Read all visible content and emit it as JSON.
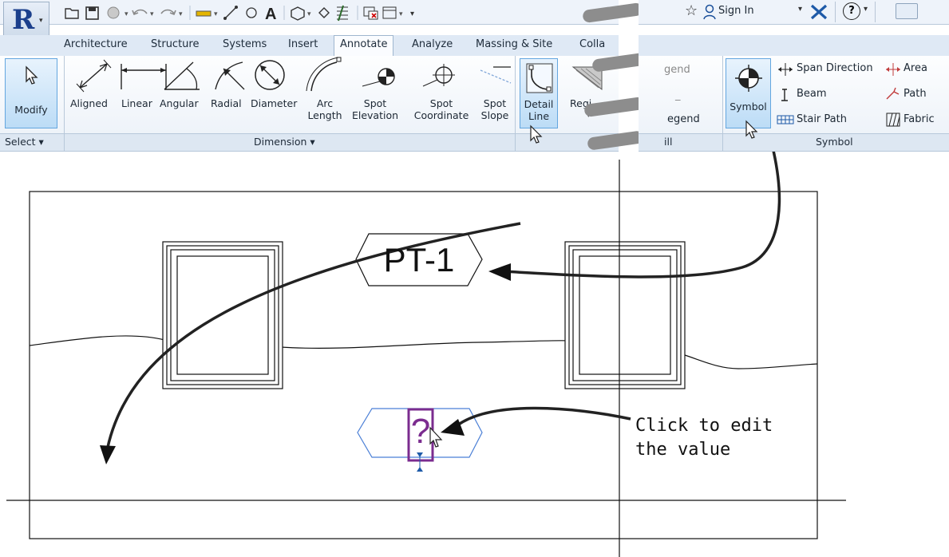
{
  "app": {
    "logo_letter": "R"
  },
  "tabs": [
    {
      "label": "Architecture"
    },
    {
      "label": "Structure"
    },
    {
      "label": "Systems"
    },
    {
      "label": "Insert"
    },
    {
      "label": "Annotate",
      "active": true
    },
    {
      "label": "Analyze"
    },
    {
      "label": "Massing & Site"
    },
    {
      "label": "Colla"
    }
  ],
  "qat_right": {
    "sign_in_label": "Sign In",
    "help_label": "?"
  },
  "select_panel": {
    "modify_label": "Modify",
    "title": "Select ▾"
  },
  "dimension_panel": {
    "title": "Dimension ▾",
    "tools": [
      {
        "line1": "Aligned",
        "line2": ""
      },
      {
        "line1": "Linear",
        "line2": ""
      },
      {
        "line1": "Angular",
        "line2": ""
      },
      {
        "line1": "Radial",
        "line2": ""
      },
      {
        "line1": "Diameter",
        "line2": ""
      },
      {
        "line1": "Arc",
        "line2": "Length"
      },
      {
        "line1": "Spot",
        "line2": "Elevation"
      },
      {
        "line1": "Spot",
        "line2": "Coordinate"
      },
      {
        "line1": "Spot",
        "line2": "Slope"
      }
    ]
  },
  "detail_panel": {
    "detail_line_1": "Detail",
    "detail_line_2": "Line",
    "region_label": "Regi"
  },
  "partial_panel": {
    "legend_label": "gend",
    "legend2_label": "egend",
    "title": "ill"
  },
  "symbol_panel": {
    "title": "Symbol",
    "symbol_label": "Symbol",
    "items": [
      {
        "label": "Span Direction"
      },
      {
        "label": "Beam"
      },
      {
        "label": "Stair Path"
      },
      {
        "label": "Area"
      },
      {
        "label": "Path"
      },
      {
        "label": "Fabric"
      }
    ]
  },
  "drawing": {
    "tag_value": "PT-1",
    "placeholder_value": "?",
    "callout_line1": "Click to edit",
    "callout_line2": "the value"
  },
  "colors": {
    "highlight_border": "#63a6df",
    "tag_placeholder_purple": "#7b2c8f",
    "placeholder_outline_blue": "#4a7fd6"
  }
}
